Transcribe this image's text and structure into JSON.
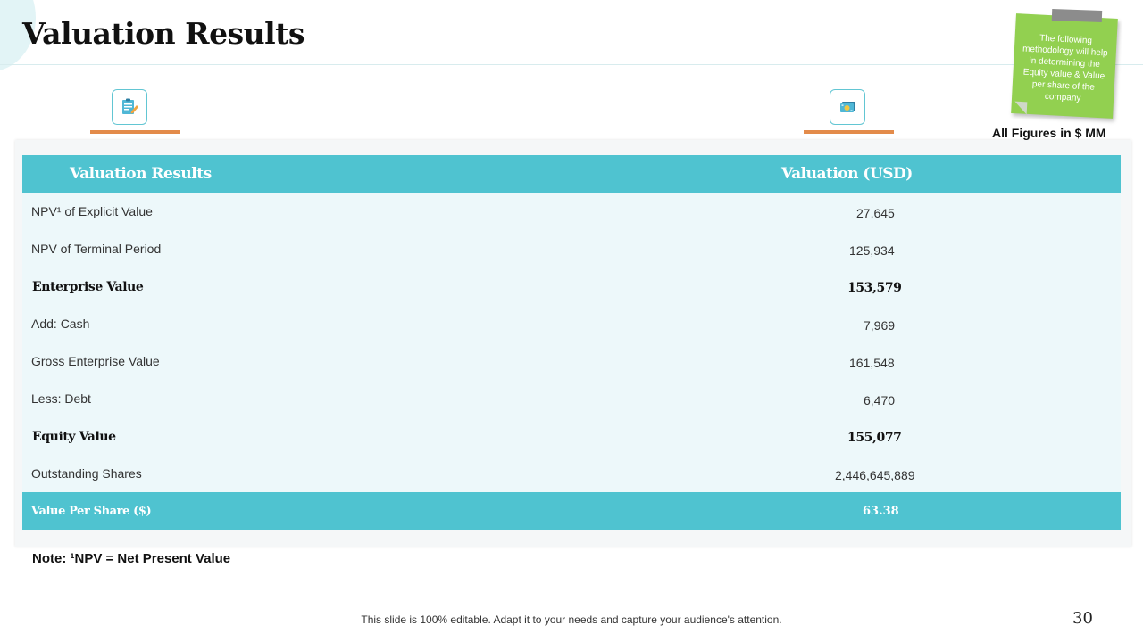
{
  "title": "Valuation Results",
  "sticky_note": "The following methodology will help in determining the Equity value & Value per share of the company",
  "figures_note": "All Figures in $ MM",
  "icons": {
    "left": "clipboard-edit-icon",
    "right": "money-icon"
  },
  "colors": {
    "header": "#4fc3d0",
    "row_bg": "#edf8fa",
    "accent": "#e38b4a",
    "note": "#92d050"
  },
  "table": {
    "headers": [
      "Valuation Results",
      "Valuation (USD)"
    ],
    "rows": [
      {
        "label": "NPV¹ of Explicit Value",
        "value": "27,645",
        "bold": false
      },
      {
        "label": "NPV of Terminal Period",
        "value": "125,934",
        "bold": false
      },
      {
        "label": "Enterprise Value",
        "value": "153,579",
        "bold": true
      },
      {
        "label": "Add: Cash",
        "value": "7,969",
        "bold": false
      },
      {
        "label": "Gross Enterprise Value",
        "value": "161,548",
        "bold": false
      },
      {
        "label": "Less: Debt",
        "value": "6,470",
        "bold": false
      },
      {
        "label": "Equity Value",
        "value": "155,077",
        "bold": true
      },
      {
        "label": "Outstanding Shares",
        "value": "2,446,645,889",
        "bold": false
      }
    ],
    "footer": {
      "label": "Value Per Share ($)",
      "value": "63.38"
    }
  },
  "footnote": "Note: ¹NPV = Net Present Value",
  "editable_text": "This slide is 100% editable. Adapt it to your needs and capture your audience's attention.",
  "page_number": "30"
}
